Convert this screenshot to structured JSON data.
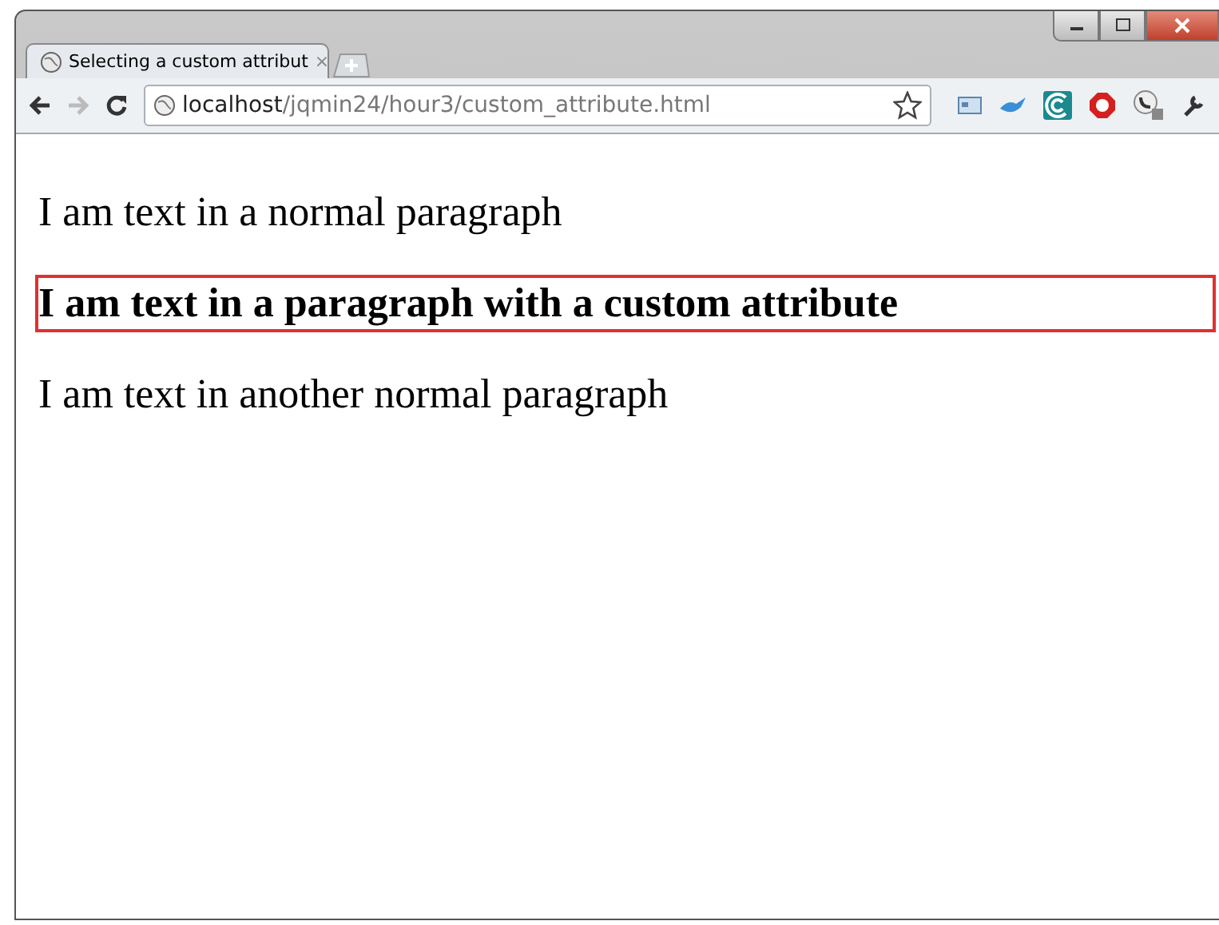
{
  "tabs": [
    {
      "title": "Selecting a custom attribut",
      "close": "×"
    }
  ],
  "address": {
    "host": "localhost",
    "path": "/jqmin24/hour3/custom_attribute.html"
  },
  "paragraphs": [
    {
      "kind": "normal",
      "text": "I am text in a normal paragraph"
    },
    {
      "kind": "custom",
      "text": "I am text in a paragraph with a custom attribute"
    },
    {
      "kind": "normal",
      "text": "I am text in another normal paragraph"
    }
  ]
}
